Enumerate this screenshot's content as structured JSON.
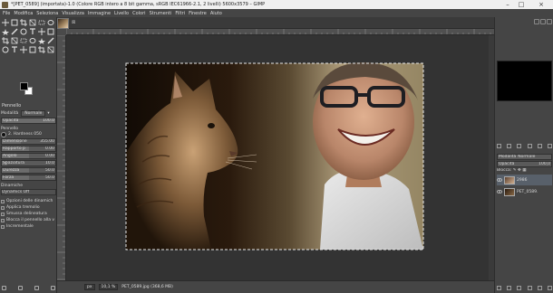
{
  "window": {
    "title": "*[PET_0589] (importata)-1.0 (Colore RGB intero a 8 bit gamma, sRGB IEC61966-2.1, 2 livelli) 5600x3579 – GIMP",
    "controls": [
      "–",
      "□",
      "×"
    ]
  },
  "menu": [
    "File",
    "Modifica",
    "Seleziona",
    "Visualizza",
    "Immagine",
    "Livello",
    "Colori",
    "Strumenti",
    "Filtri",
    "Finestre",
    "Aiuto"
  ],
  "tools": [
    "move-tool",
    "align-tool",
    "crop-tool",
    "unified-transform-tool",
    "rect-select-tool",
    "lasso-tool",
    "fuzzy-select-tool",
    "foreground-select-tool",
    "paths-tool",
    "text-tool",
    "clone-tool",
    "smudge-tool",
    "paintbrush-tool",
    "eraser-tool",
    "bucket-fill-tool",
    "dodge-tool",
    "color-picker-tool",
    "zoom-tool",
    "measure-tool",
    "warp-tool",
    "heal-tool",
    "ink-tool",
    "airbrush-tool",
    "gradient-tool"
  ],
  "tool_options": {
    "title": "Pennello",
    "mode_label": "Modalità",
    "mode_value": "Normale",
    "opacity_label": "Opacità",
    "opacity_value": "100.0",
    "brush_label": "Pennello",
    "brush_value": "2. Hardness 050",
    "sliders": [
      {
        "label": "Dimensione",
        "value": "355.00",
        "fill": 0.35
      },
      {
        "label": "Rapporto p",
        "value": "0.00",
        "fill": 0.5
      },
      {
        "label": "Angolo",
        "value": "0.00",
        "fill": 0.5
      },
      {
        "label": "Spaziatura",
        "value": "10.0",
        "fill": 0.1
      },
      {
        "label": "Durezza",
        "value": "50.0",
        "fill": 0.5
      },
      {
        "label": "Forza",
        "value": "50.0",
        "fill": 0.5
      }
    ],
    "dynamics_label": "Dinamiche",
    "dynamics_value": "Dynamics Off",
    "checks": [
      {
        "label": "Opzioni delle dinamich",
        "on": false
      },
      {
        "label": "Applica tremolio",
        "on": false
      },
      {
        "label": "Smussa delineatura",
        "on": false
      },
      {
        "label": "Blocca il pennello alla v",
        "on": false
      },
      {
        "label": "Incrementale",
        "on": false
      }
    ]
  },
  "tabs": {
    "close_glyph": "⊠"
  },
  "status": {
    "unit": "px",
    "zoom": "10,1 %",
    "file": "PET_0589.jpg (368,6 MB)"
  },
  "layers": {
    "mode_label": "Modalità",
    "mode_value": "Normale",
    "opacity_label": "Opacità",
    "opacity_value": "100,0",
    "lock_label": "Blocca:",
    "items": [
      {
        "name": "2986",
        "selected": true
      },
      {
        "name": "PET_0589.",
        "selected": false
      }
    ]
  },
  "colors": {
    "accent": "#58606a",
    "canvas": "#333333",
    "panel": "#454545"
  }
}
